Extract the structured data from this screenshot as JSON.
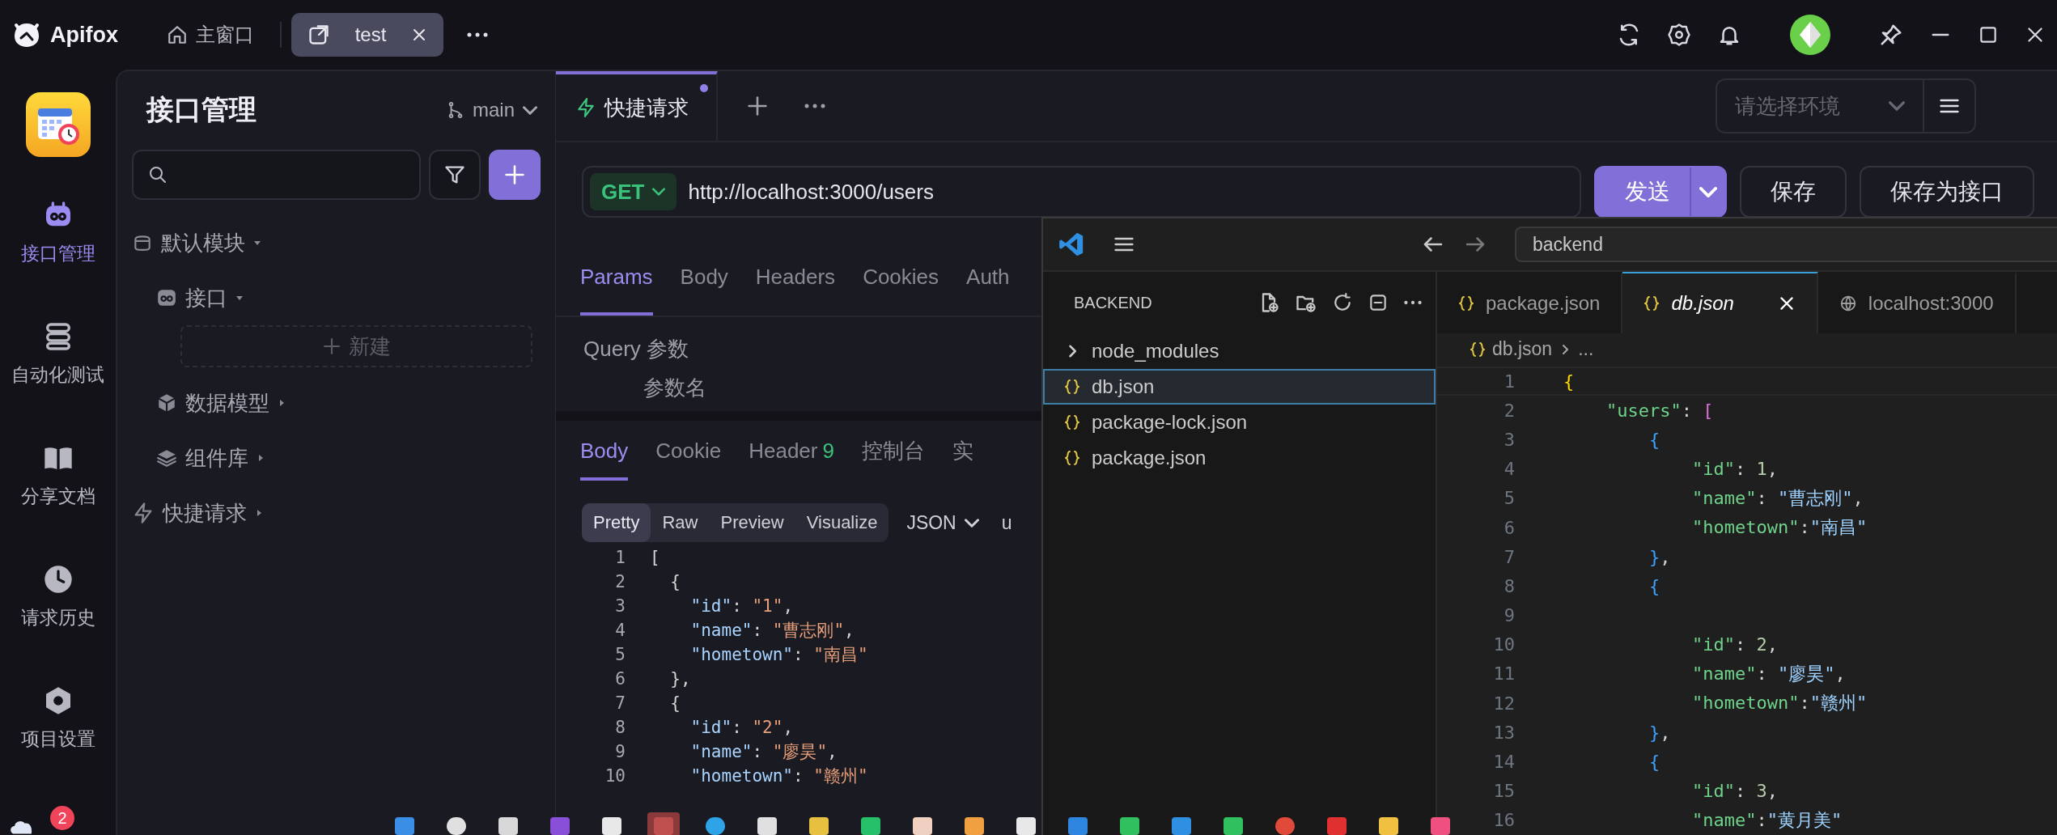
{
  "titlebar": {
    "app_name": "Apifox",
    "tabs": [
      {
        "label": "主窗口",
        "kind": "home",
        "selected": false
      },
      {
        "label": "test",
        "kind": "window",
        "selected": true
      }
    ]
  },
  "nav": {
    "items": [
      {
        "label": "接口管理",
        "kind": "api",
        "selected": true
      },
      {
        "label": "自动化测试",
        "kind": "test",
        "selected": false
      },
      {
        "label": "分享文档",
        "kind": "docs",
        "selected": false
      },
      {
        "label": "请求历史",
        "kind": "history",
        "selected": false
      },
      {
        "label": "项目设置",
        "kind": "settings",
        "selected": false
      }
    ],
    "badge": "2"
  },
  "panel": {
    "title": "接口管理",
    "branch": "main",
    "tree": [
      {
        "label": "默认模块",
        "kind": "module",
        "expanded": true,
        "children": [
          {
            "label": "接口",
            "kind": "api",
            "expanded": true,
            "children": [
              {
                "label": "新建",
                "kind": "new"
              }
            ]
          },
          {
            "label": "数据模型",
            "kind": "model",
            "expanded": false
          },
          {
            "label": "组件库",
            "kind": "library",
            "expanded": false
          }
        ]
      },
      {
        "label": "快捷请求",
        "kind": "quick",
        "expanded": false
      }
    ]
  },
  "main": {
    "request_tabs": [
      {
        "label": "快捷请求",
        "selected": true,
        "modified": true
      }
    ],
    "environment": {
      "placeholder": "请选择环境"
    },
    "request": {
      "method": "GET",
      "url": "http://localhost:3000/users",
      "buttons": [
        {
          "label": "发送",
          "kind": "primary"
        },
        {
          "label": "保存",
          "kind": "default"
        },
        {
          "label": "保存为接口",
          "kind": "default"
        }
      ]
    },
    "param_tabs": [
      {
        "label": "Params",
        "selected": true
      },
      {
        "label": "Body",
        "selected": false
      },
      {
        "label": "Headers",
        "selected": false
      },
      {
        "label": "Cookies",
        "selected": false
      },
      {
        "label": "Auth",
        "selected": false
      }
    ],
    "query": {
      "title": "Query 参数",
      "column": "参数名"
    },
    "response_tabs": [
      {
        "label": "Body",
        "selected": true
      },
      {
        "label": "Cookie",
        "selected": false
      },
      {
        "label": "Header",
        "count": "9",
        "selected": false
      },
      {
        "label": "控制台",
        "selected": false
      },
      {
        "label": "实",
        "selected": false
      }
    ],
    "views": [
      {
        "label": "Pretty",
        "selected": true
      },
      {
        "label": "Raw",
        "selected": false
      },
      {
        "label": "Preview",
        "selected": false
      },
      {
        "label": "Visualize",
        "selected": false
      }
    ],
    "format": "JSON",
    "column_3": "u",
    "body_lines": [
      {
        "number": "1",
        "text": "["
      },
      {
        "number": "2",
        "text": "  {"
      },
      {
        "number": "3",
        "text": "    \"id\": \"1\","
      },
      {
        "number": "4",
        "text": "    \"name\": \"曹志刚\","
      },
      {
        "number": "5",
        "text": "    \"hometown\": \"南昌\""
      },
      {
        "number": "6",
        "text": "  },"
      },
      {
        "number": "7",
        "text": "  {"
      },
      {
        "number": "8",
        "text": "    \"id\": \"2\","
      },
      {
        "number": "9",
        "text": "    \"name\": \"廖昊\","
      },
      {
        "number": "10",
        "text": "    \"hometown\": \"赣州\""
      }
    ]
  },
  "vscode": {
    "search": "backend",
    "explorer_title": "BACKEND",
    "files": [
      {
        "label": "node_modules",
        "kind": "folder",
        "expanded": false,
        "selected": false
      },
      {
        "label": "db.json",
        "kind": "json",
        "selected": true
      },
      {
        "label": "package-lock.json",
        "kind": "json",
        "selected": false
      },
      {
        "label": "package.json",
        "kind": "json",
        "selected": false
      }
    ],
    "tabs": [
      {
        "label": "package.json",
        "kind": "json",
        "selected": false,
        "preview": false
      },
      {
        "label": "db.json",
        "kind": "json",
        "selected": true,
        "preview": true
      },
      {
        "label": "localhost:3000",
        "kind": "web",
        "selected": false,
        "preview": false
      }
    ],
    "breadcrumb": [
      "db.json",
      "..."
    ],
    "lines": [
      {
        "number": "1",
        "text": "{"
      },
      {
        "number": "2",
        "text": "    \"users\": ["
      },
      {
        "number": "3",
        "text": "        {"
      },
      {
        "number": "4",
        "text": "            \"id\": 1,"
      },
      {
        "number": "5",
        "text": "            \"name\": \"曹志刚\","
      },
      {
        "number": "6",
        "text": "            \"hometown\":\"南昌\""
      },
      {
        "number": "7",
        "text": "        },"
      },
      {
        "number": "8",
        "text": "        {"
      },
      {
        "number": "9"
      },
      {
        "number": "10",
        "text": "            \"id\": 2,"
      },
      {
        "number": "11",
        "text": "            \"name\": \"廖昊\","
      },
      {
        "number": "12",
        "text": "            \"hometown\":\"赣州\""
      },
      {
        "number": "13",
        "text": "        },"
      },
      {
        "number": "14",
        "text": "        {"
      },
      {
        "number": "15",
        "text": "            \"id\": 3,"
      },
      {
        "number": "16",
        "text": "            \"name\":\"黄月美\""
      }
    ]
  }
}
